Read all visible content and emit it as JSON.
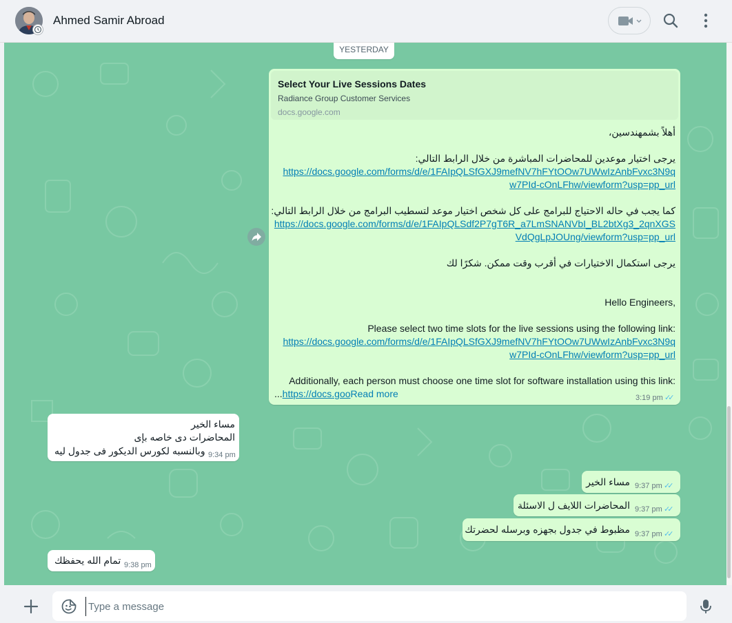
{
  "header": {
    "contact_name": "Ahmed Samir Abroad"
  },
  "date_separator": "YESTERDAY",
  "message_big": {
    "preview_title": "Select Your Live Sessions Dates",
    "preview_desc": "Radiance Group Customer Services",
    "preview_domain": "docs.google.com",
    "lines": {
      "l1": "أهلاً بشمهندسين،",
      "l2": "يرجى اختيار موعدين للمحاضرات المباشرة من خلال الرابط التالي:",
      "l3": "https://docs.google.com/forms/d/e/1FAIpQLSfGXJ9mefNV7hFYtOOw7UWwIzAnbFvxc3N9q",
      "l4": "w7PId-cOnLFhw/viewform?usp=pp_url",
      "l5": "كما يجب في حاله الاحتياج للبرامج على كل شخص اختيار موعد لتسطيب البرامج من خلال الرابط التالي:",
      "l6": "https://docs.google.com/forms/d/e/1FAIpQLSdf2P7gT6R_a7LmSNANVbI_BL2btXg3_2qnXGS",
      "l7": "VdQgLpJOUng/viewform?usp=pp_url",
      "l8": "يرجى استكمال الاختيارات في أقرب وقت ممكن. شكرًا لك",
      "l9": "Hello Engineers,",
      "l10": "Please select two time slots for the live sessions using the following link:",
      "l11": "https://docs.google.com/forms/d/e/1FAIpQLSfGXJ9mefNV7hFYtOOw7UWwIzAnbFvxc3N9q",
      "l12": "w7PId-cOnLFhw/viewform?usp=pp_url",
      "l13": "Additionally, each person must choose one time slot for software installation using this link:",
      "l14_link": "https://docs.goo",
      "l14_dots": "...",
      "read_more": "Read more"
    },
    "time": "3:19 pm"
  },
  "message_in_1": {
    "lines": [
      "مساء الخير",
      "المحاضرات دى خاصه بإى",
      "وبالنسبه لكورس الديكور فى جدول ليه"
    ],
    "time": "9:34 pm"
  },
  "message_out_1": {
    "text": "مساء الخير",
    "time": "9:37 pm"
  },
  "message_out_2": {
    "text": "المحاضرات اللايف ل الاسئلة",
    "time": "9:37 pm"
  },
  "message_out_3": {
    "text": "مظبوط في جدول بجهزه وبرسله لحضرتك",
    "time": "9:37 pm"
  },
  "message_in_2": {
    "text": "تمام الله يحفظك",
    "time": "9:38 pm"
  },
  "composer": {
    "placeholder": "Type a message"
  },
  "icons": {
    "video": "video-camera-icon",
    "search": "search-icon",
    "menu": "menu-kebab-icon",
    "plus": "plus-icon",
    "sticker": "sticker-icon",
    "mic": "microphone-icon",
    "forward": "forward-icon"
  },
  "colors": {
    "chat_bg": "#78c8a2",
    "outgoing_bubble": "#d9fdd3",
    "incoming_bubble": "#ffffff",
    "link": "#027eb5",
    "read_ticks": "#53bdeb"
  }
}
